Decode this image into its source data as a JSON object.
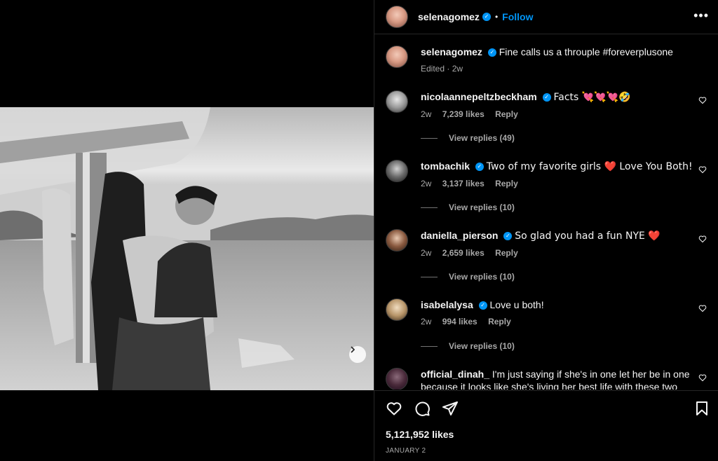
{
  "post": {
    "author": "selenagomez",
    "follow_label": "Follow",
    "dot": "•",
    "more_label": "•••",
    "caption_author": "selenagomez",
    "caption_text": "Fine calls us a throuple #foreverplusone",
    "caption_meta": "Edited · 2w"
  },
  "comments": [
    {
      "user": "nicolaannepeltzbeckham",
      "text": "Facts 💘💘💘🤣",
      "age": "2w",
      "likes": "7,239 likes",
      "reply": "Reply",
      "view_replies": "View replies (49)"
    },
    {
      "user": "tombachik",
      "text": "Two of my favorite girls ❤️ Love You Both!",
      "age": "2w",
      "likes": "3,137 likes",
      "reply": "Reply",
      "view_replies": "View replies (10)"
    },
    {
      "user": "daniella_pierson",
      "text": "So glad you had a fun NYE ❤️",
      "age": "2w",
      "likes": "2,659 likes",
      "reply": "Reply",
      "view_replies": "View replies (10)"
    },
    {
      "user": "isabelalysa",
      "text": "Love u both!",
      "age": "2w",
      "likes": "994 likes",
      "reply": "Reply",
      "view_replies": "View replies (10)"
    },
    {
      "user": "official_dinah_",
      "text": "I'm just saying if she's in one let her be in one because it looks like she's living her best life with these two"
    }
  ],
  "footer": {
    "likes": "5,121,952 likes",
    "date": "JANUARY 2"
  },
  "colors": {
    "accent": "#0095f6",
    "muted": "#a8a8a8",
    "border": "#262626"
  },
  "icons": [
    "heart-icon",
    "comment-icon",
    "share-icon",
    "bookmark-icon",
    "verified-icon",
    "chevron-right-icon",
    "more-icon"
  ]
}
